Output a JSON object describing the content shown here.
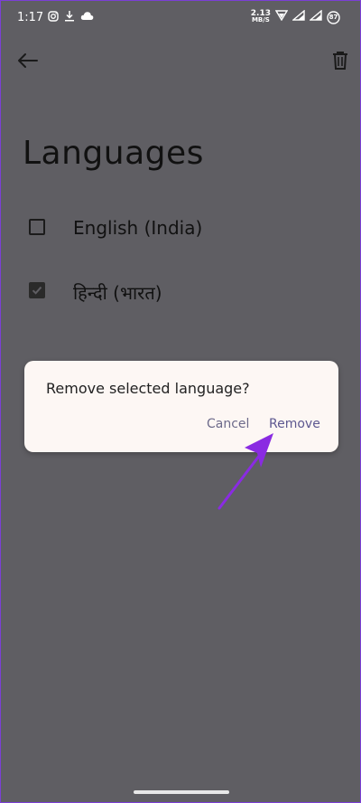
{
  "status_bar": {
    "time": "1:17",
    "net_speed_value": "2.13",
    "net_speed_unit": "MB/S",
    "battery_level": "87",
    "icons_left": [
      "instagram-icon",
      "download-icon",
      "cloud-icon"
    ],
    "icons_right": [
      "wifi-icon",
      "signal-icon",
      "signal-icon",
      "battery-icon"
    ]
  },
  "top_bar": {
    "back_icon": "arrow-left-icon",
    "delete_icon": "trash-icon"
  },
  "page": {
    "title": "Languages"
  },
  "languages": [
    {
      "label": "English (India)",
      "checked": false
    },
    {
      "label": "हिन्दी (भारत)",
      "checked": true
    }
  ],
  "dialog": {
    "message": "Remove selected language?",
    "cancel_label": "Cancel",
    "remove_label": "Remove"
  },
  "colors": {
    "scrim": "#5f5e63",
    "dialog_bg": "#fdf7f4",
    "accent_arrow": "#8a2be2",
    "button_text": "#5d5890"
  }
}
